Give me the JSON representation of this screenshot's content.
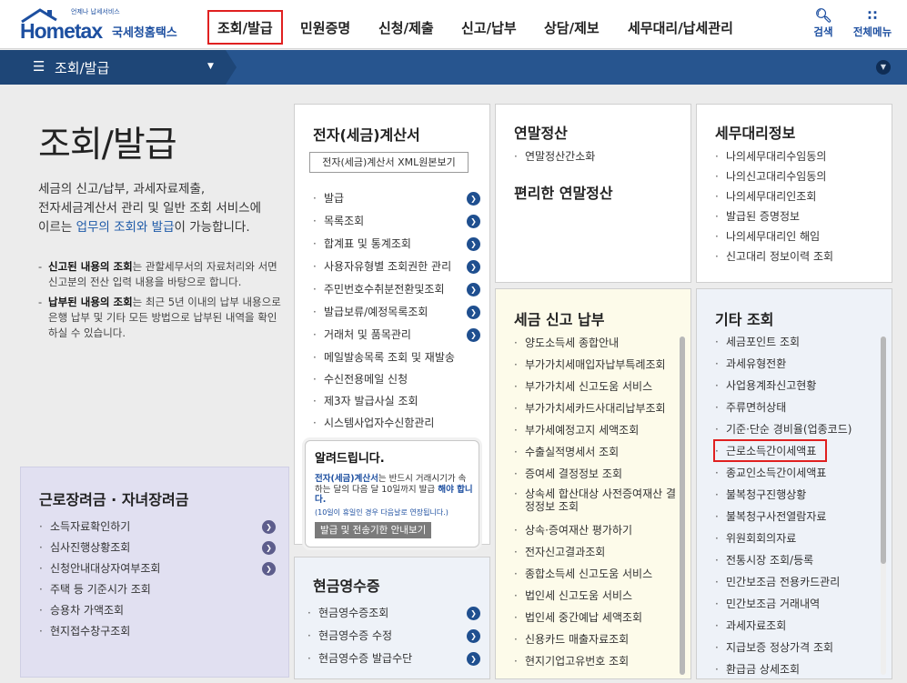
{
  "header": {
    "logo_small": "언제나 납세서비스",
    "logo_main": "Hometax",
    "logo_kr": "국세청홈택스",
    "nav": [
      "조회/발급",
      "민원증명",
      "신청/제출",
      "신고/납부",
      "상담/제보",
      "세무대리/납세관리"
    ],
    "search_label": "검색",
    "menu_label": "전체메뉴"
  },
  "subbar": {
    "title": "조회/발급"
  },
  "intro": {
    "title": "조회/발급",
    "desc_1": "세금의 신고/납부, 과세자료제출,",
    "desc_2": "전자세금계산서 관리 및 일반 조회 서비스에",
    "desc_3_a": "이르는 ",
    "desc_3_hl": "업무의 조회와 발급",
    "desc_3_b": "이 가능합니다.",
    "note1_bold": "신고된 내용의 조회",
    "note1_rest": "는 관할세무서의 자료처리와 서면신고분의 전산 입력 내용을 바탕으로 합니다.",
    "note2_bold": "납부된 내용의 조회",
    "note2_rest": "는 최근 5년 이내의 납부 내용으로 은행 납부 및 기타 모든 방법으로 납부된 내역을 확인하실 수 있습니다."
  },
  "panels": {
    "einvoice": {
      "title": "전자(세금)계산서",
      "xml_button": "전자(세금)계산서 XML원본보기",
      "items": [
        "발급",
        "목록조회",
        "합계표 및 통계조회",
        "사용자유형별 조회권한 관리",
        "주민번호수취분전환및조회",
        "발급보류/예정목록조회",
        "거래처 및 품목관리",
        "메일발송목록 조회 및 재발송",
        "수신전용메일 신청",
        "제3자 발급사실 조회",
        "시스템사업자수신함관리"
      ]
    },
    "notice": {
      "title": "알려드립니다.",
      "body_a": "전자(세금)계산서",
      "body_b": "는 반드시 거래시기가 속하는 달의 다음 달 10일까지 발급",
      "body_c": "해야 합니다.",
      "small": "(10일이 휴일인 경우 다음날로 연장됩니다.)",
      "button": "발급 및 전송기한 안내보기"
    },
    "yearend": {
      "title": "연말정산",
      "items": [
        "연말정산간소화"
      ],
      "subtitle": "편리한 연말정산"
    },
    "taxagent": {
      "title": "세무대리정보",
      "items": [
        "나의세무대리수임동의",
        "나의신고대리수임동의",
        "나의세무대리인조회",
        "발급된 증명정보",
        "나의세무대리인 해임",
        "신고대리 정보이력 조회"
      ]
    },
    "filing": {
      "title": "세금 신고 납부",
      "items": [
        "양도소득세 종합안내",
        "부가가치세매입자납부특례조회",
        "부가가치세 신고도움 서비스",
        "부가가치세카드사대리납부조회",
        "부가세예정고지 세액조회",
        "수출실적명세서 조회",
        "증여세 결정정보 조회",
        "상속세 합산대상 사전증여재산 결정정보 조회",
        "상속·증여재산 평가하기",
        "전자신고결과조회",
        "종합소득세 신고도움 서비스",
        "법인세 신고도움 서비스",
        "법인세 중간예납 세액조회",
        "신용카드 매출자료조회",
        "현지기업고유번호 조회"
      ]
    },
    "other": {
      "title": "기타 조회",
      "items": [
        "세금포인트 조회",
        "과세유형전환",
        "사업용계좌신고현황",
        "주류면허상태",
        "기준·단순 경비율(업종코드)",
        "근로소득간이세액표",
        "종교인소득간이세액표",
        "불복청구진행상황",
        "불복청구사전열람자료",
        "위원회회의자료",
        "전통시장 조회/등록",
        "민간보조금 전용카드관리",
        "민간보조금 거래내역",
        "과세자료조회",
        "지급보증 정상가격 조회",
        "환급금 상세조회"
      ]
    },
    "eitc": {
      "title": "근로장려금 · 자녀장려금",
      "items": [
        "소득자료확인하기",
        "심사진행상황조회",
        "신청안내대상자여부조회",
        "주택 등 기준시가 조회",
        "승용차 가액조회",
        "현지접수창구조회"
      ]
    },
    "cash": {
      "title": "현금영수증",
      "items": [
        "현금영수증조회",
        "현금영수증 수정",
        "현금영수증 발급수단"
      ]
    }
  }
}
